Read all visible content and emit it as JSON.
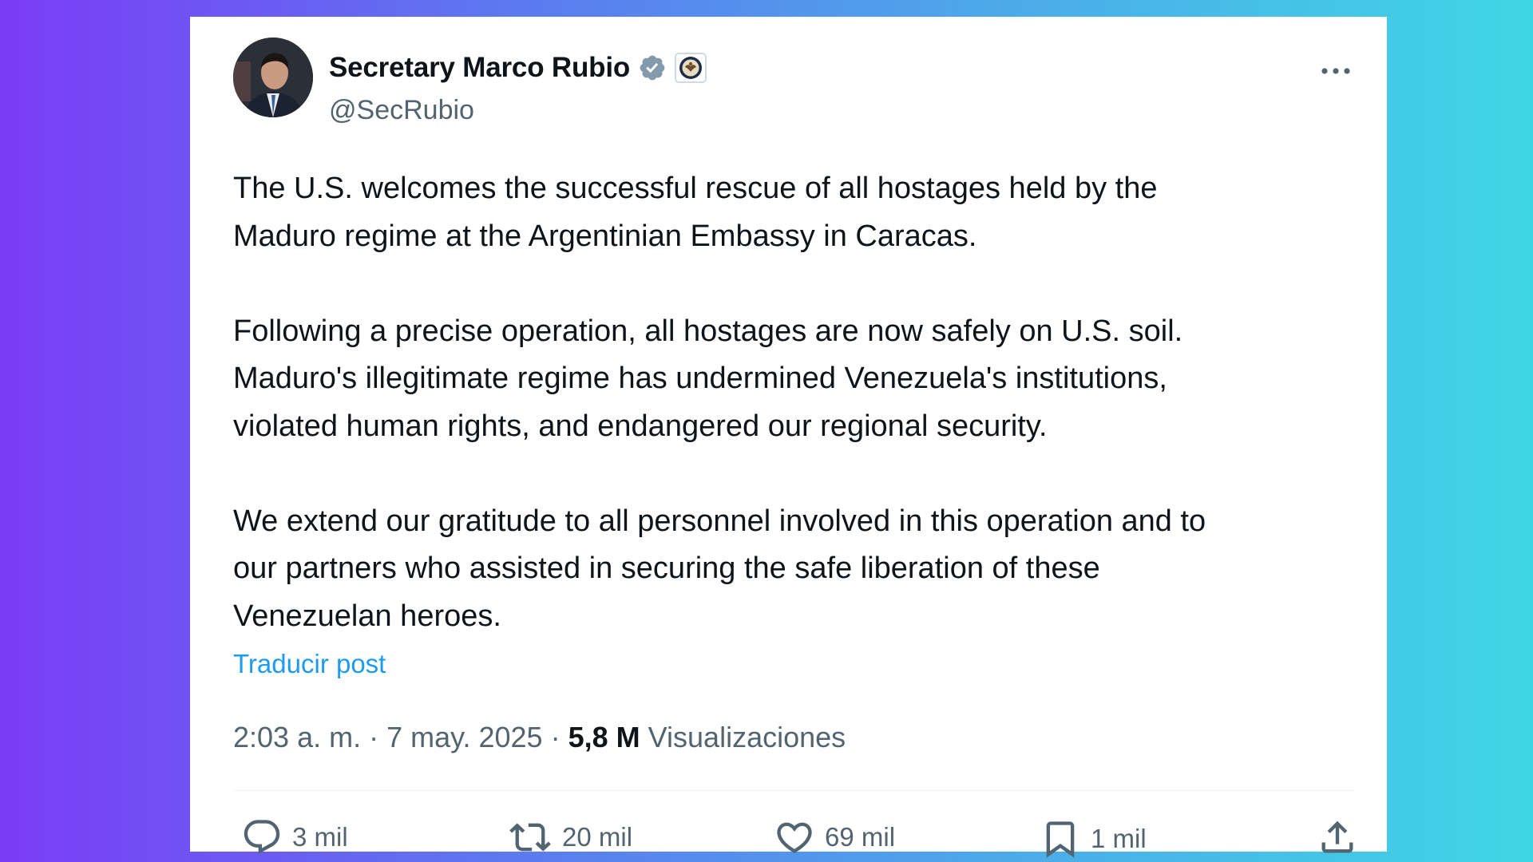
{
  "post": {
    "author": {
      "display_name": "Secretary Marco Rubio",
      "handle": "@SecRubio"
    },
    "paragraphs": [
      "The U.S. welcomes the successful rescue of all hostages held by the\nMaduro regime at the Argentinian Embassy in Caracas.",
      "Following a precise operation, all hostages are now safely on U.S. soil.\nMaduro's illegitimate regime has undermined Venezuela's institutions,\nviolated human rights, and endangered our regional security.",
      "We extend our gratitude to all personnel involved in this operation and to\nour partners who assisted in securing the safe liberation of these\nVenezuelan heroes."
    ],
    "translate_label": "Traducir post",
    "time": "2:03 a. m.",
    "date": "7 may. 2025",
    "separator": "·",
    "views_count": "5,8 M",
    "views_label": "Visualizaciones"
  },
  "actions": {
    "replies": "3 mil",
    "reposts": "20 mil",
    "likes": "69 mil",
    "bookmarks": "1 mil"
  },
  "icons": {
    "verified": "verified-badge-icon",
    "affiliation": "state-department-seal-icon",
    "more": "more-horizontal-icon",
    "reply": "reply-icon",
    "repost": "repost-icon",
    "like": "heart-icon",
    "bookmark": "bookmark-icon",
    "share": "share-icon"
  },
  "colors": {
    "link": "#1d9bf0",
    "verified_badge": "#829aab",
    "text_primary": "#0f1419",
    "text_secondary": "#536471"
  }
}
